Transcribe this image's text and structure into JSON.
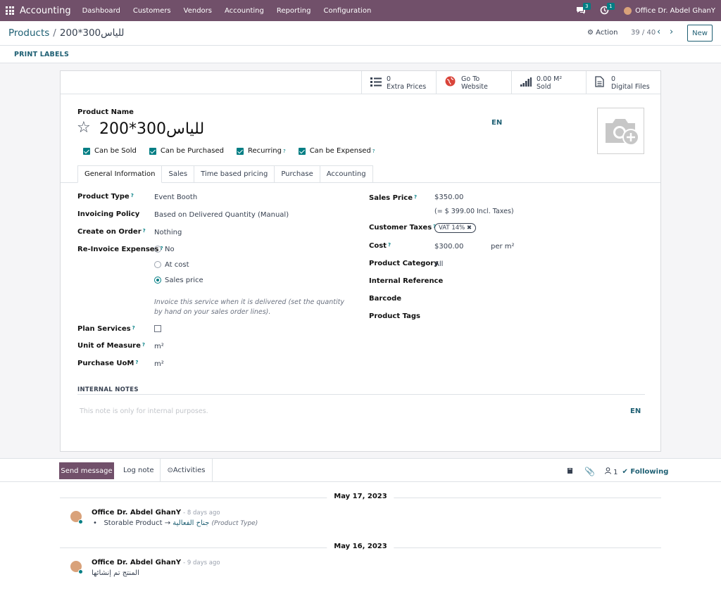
{
  "navbar": {
    "app_name": "Accounting",
    "menu": [
      "Dashboard",
      "Customers",
      "Vendors",
      "Accounting",
      "Reporting",
      "Configuration"
    ],
    "messages_count": "3",
    "activities_count": "1",
    "user_name": "Office Dr. Abdel GhanY",
    "icons": {
      "apps": "apps-grid-icon",
      "messages": "chat-icon",
      "activities": "clock-icon"
    }
  },
  "control_panel": {
    "breadcrumb_parent": "Products",
    "breadcrumb_separator": "/",
    "breadcrumb_current": "200*300للياس",
    "action_label": "Action",
    "pager": "39 / 40",
    "new_label": "New"
  },
  "status_bar": {
    "print_labels": "PRINT LABELS"
  },
  "smart_buttons": [
    {
      "icon": "list-icon",
      "value": "0",
      "label": "Extra Prices"
    },
    {
      "icon": "globe-icon",
      "value": "Go To",
      "label": "Website"
    },
    {
      "icon": "signal-bars-icon",
      "value": "0.00 M²",
      "label": "Sold"
    },
    {
      "icon": "file-icon",
      "value": "0",
      "label": "Digital Files"
    }
  ],
  "product": {
    "name_label": "Product Name",
    "name": "200*300للياس",
    "lang": "EN",
    "checkboxes": [
      {
        "label": "Can be Sold",
        "checked": true,
        "help": false
      },
      {
        "label": "Can be Purchased",
        "checked": true,
        "help": false
      },
      {
        "label": "Recurring",
        "checked": true,
        "help": true
      },
      {
        "label": "Can be Expensed",
        "checked": true,
        "help": true
      }
    ]
  },
  "tabs": [
    "General Information",
    "Sales",
    "Time based pricing",
    "Purchase",
    "Accounting"
  ],
  "general": {
    "product_type_label": "Product Type",
    "product_type": "Event Booth",
    "invoicing_policy_label": "Invoicing Policy",
    "invoicing_policy": "Based on Delivered Quantity (Manual)",
    "create_on_order_label": "Create on Order",
    "create_on_order": "Nothing",
    "reinvoice_label": "Re-Invoice Expenses",
    "reinvoice_options": [
      "No",
      "At cost",
      "Sales price"
    ],
    "reinvoice_selected": "Sales price",
    "help_text": "Invoice this service when it is delivered (set the quantity by hand on your sales order lines).",
    "plan_services_label": "Plan Services",
    "uom_label": "Unit of Measure",
    "uom": "m²",
    "purchase_uom_label": "Purchase UoM",
    "purchase_uom": "m²",
    "sales_price_label": "Sales Price",
    "sales_price": "$350.00",
    "sales_price_incl": "(= $ 399.00 Incl. Taxes)",
    "customer_taxes_label": "Customer Taxes",
    "customer_tax_tag": "VAT 14%",
    "cost_label": "Cost",
    "cost": "$300.00",
    "cost_unit": "per m²",
    "category_label": "Product Category",
    "category": "All",
    "internal_ref_label": "Internal Reference",
    "barcode_label": "Barcode",
    "tags_label": "Product Tags"
  },
  "notes": {
    "title": "INTERNAL NOTES",
    "placeholder": "This note is only for internal purposes.",
    "lang": "EN"
  },
  "chatter": {
    "send_message": "Send message",
    "log_note": "Log note",
    "activities": "Activities",
    "followers_count": "1",
    "following": "Following",
    "messages": [
      {
        "date": "May 17, 2023",
        "author": "Office Dr. Abdel GhanY",
        "time": "- 8 days ago",
        "field": "Storable Product",
        "arrow": "→",
        "new_value": "جناح الفعالية",
        "field_name": "(Product Type)"
      },
      {
        "date": "May 16, 2023",
        "author": "Office Dr. Abdel GhanY",
        "time": "- 9 days ago",
        "body": "المنتج تم إنشائها"
      }
    ]
  },
  "colors": {
    "brand": "#71506a",
    "accent": "#017e84",
    "link": "#1e5f73"
  }
}
